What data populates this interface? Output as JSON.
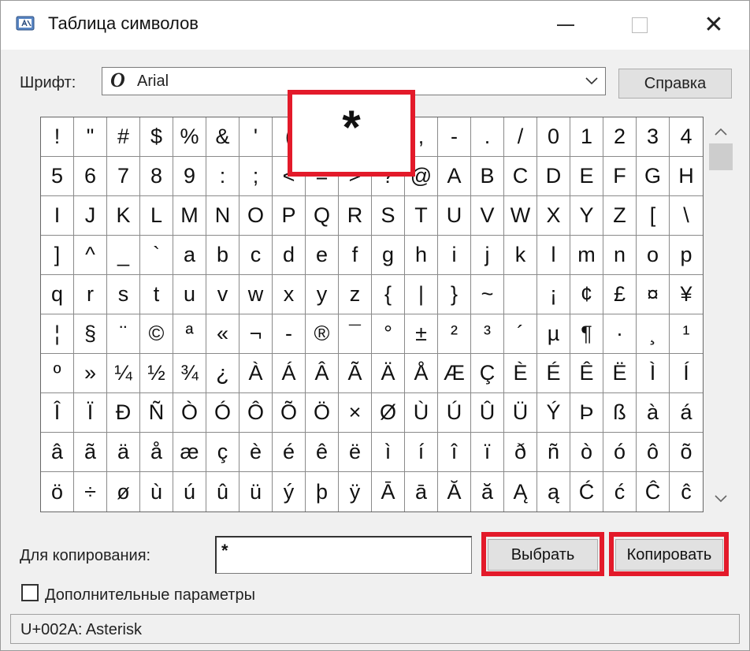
{
  "window": {
    "title": "Таблица символов"
  },
  "font": {
    "label": "Шрифт:",
    "selected": "Arial",
    "font_icon_glyph": "O"
  },
  "buttons": {
    "help": "Справка",
    "select": "Выбрать",
    "copy": "Копировать"
  },
  "grid": {
    "cells": [
      "!",
      "\"",
      "#",
      "$",
      "%",
      "&",
      "'",
      "(",
      ")",
      "*",
      "+",
      ",",
      "-",
      ".",
      "/",
      "0",
      "1",
      "2",
      "3",
      "4",
      "5",
      "6",
      "7",
      "8",
      "9",
      ":",
      ";",
      "<",
      "=",
      ">",
      "?",
      "@",
      "A",
      "B",
      "C",
      "D",
      "E",
      "F",
      "G",
      "H",
      "I",
      "J",
      "K",
      "L",
      "M",
      "N",
      "O",
      "P",
      "Q",
      "R",
      "S",
      "T",
      "U",
      "V",
      "W",
      "X",
      "Y",
      "Z",
      "[",
      "\\",
      "]",
      "^",
      "_",
      "`",
      "a",
      "b",
      "c",
      "d",
      "e",
      "f",
      "g",
      "h",
      "i",
      "j",
      "k",
      "l",
      "m",
      "n",
      "o",
      "p",
      "q",
      "r",
      "s",
      "t",
      "u",
      "v",
      "w",
      "x",
      "y",
      "z",
      "{",
      "|",
      "}",
      "~",
      "",
      "¡",
      "¢",
      "£",
      "¤",
      "¥",
      "¦",
      "§",
      "¨",
      "©",
      "ª",
      "«",
      "¬",
      "-",
      "®",
      "¯",
      "°",
      "±",
      "²",
      "³",
      "´",
      "µ",
      "¶",
      "·",
      "¸",
      "¹",
      "º",
      "»",
      "¼",
      "½",
      "¾",
      "¿",
      "À",
      "Á",
      "Â",
      "Ã",
      "Ä",
      "Å",
      "Æ",
      "Ç",
      "È",
      "É",
      "Ê",
      "Ë",
      "Ì",
      "Í",
      "Î",
      "Ï",
      "Ð",
      "Ñ",
      "Ò",
      "Ó",
      "Ô",
      "Õ",
      "Ö",
      "×",
      "Ø",
      "Ù",
      "Ú",
      "Û",
      "Ü",
      "Ý",
      "Þ",
      "ß",
      "à",
      "á",
      "â",
      "ã",
      "ä",
      "å",
      "æ",
      "ç",
      "è",
      "é",
      "ê",
      "ë",
      "ì",
      "í",
      "î",
      "ï",
      "ð",
      "ñ",
      "ò",
      "ó",
      "ô",
      "õ",
      "ö",
      "÷",
      "ø",
      "ù",
      "ú",
      "û",
      "ü",
      "ý",
      "þ",
      "ÿ",
      "Ā",
      "ā",
      "Ă",
      "ă",
      "Ą",
      "ą",
      "Ć",
      "ć",
      "Ĉ",
      "ĉ"
    ],
    "selected_char": "*"
  },
  "copy": {
    "label": "Для копирования:",
    "value": "*"
  },
  "advanced": {
    "label": "Дополнительные параметры",
    "checked": false
  },
  "status": {
    "text": "U+002A: Asterisk"
  },
  "colors": {
    "highlight": "#e31a2a",
    "window_bg": "#f0f0f0",
    "button_bg": "#e1e1e1"
  }
}
